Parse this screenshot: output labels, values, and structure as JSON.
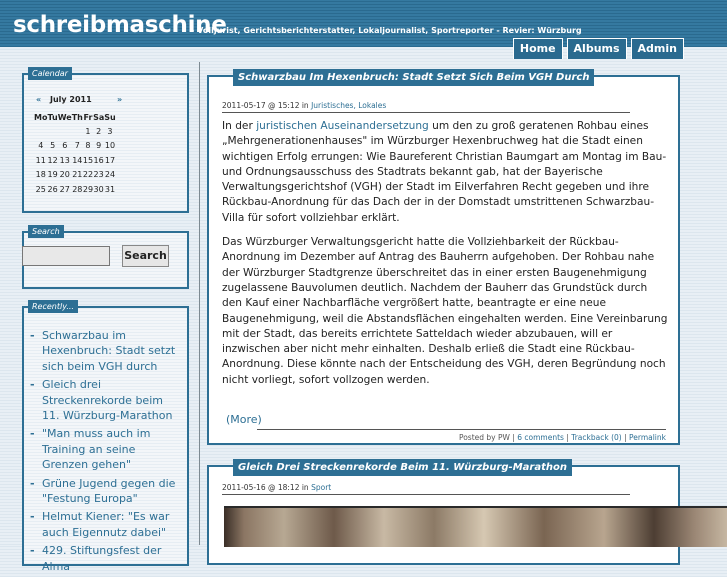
{
  "header": {
    "title": "schreibmaschine",
    "tagline": "- Volljurist, Gerichtsberichterstatter, Lokaljournalist, Sportreporter - Revier: Würzburg",
    "nav": [
      "Home",
      "Albums",
      "Admin"
    ]
  },
  "sidebar": {
    "calendar": {
      "title": "Calendar",
      "prev": "«",
      "month": "July 2011",
      "next": "»",
      "weekdays": [
        "Mo",
        "Tu",
        "We",
        "Th",
        "Fr",
        "Sa",
        "Su"
      ],
      "weeks": [
        [
          "",
          "",
          "",
          "",
          "1",
          "2",
          "3"
        ],
        [
          "4",
          "5",
          "6",
          "7",
          "8",
          "9",
          "10"
        ],
        [
          "11",
          "12",
          "13",
          "14",
          "15",
          "16",
          "17"
        ],
        [
          "18",
          "19",
          "20",
          "21",
          "22",
          "23",
          "24"
        ],
        [
          "25",
          "26",
          "27",
          "28",
          "29",
          "30",
          "31"
        ]
      ]
    },
    "search": {
      "title": "Search",
      "button": "Search"
    },
    "recent": {
      "title": "Recently...",
      "items": [
        "Schwarzbau im Hexenbruch: Stadt setzt sich beim VGH durch",
        "Gleich drei Streckenrekorde beim 11. Würzburg-Marathon",
        "\"Man muss auch im Training an seine Grenzen gehen\"",
        "Grüne Jugend gegen die \"Festung Europa\"",
        "Helmut Kiener: \"Es war auch Eigennutz dabei\"",
        "429. Stiftungsfest der Alma"
      ]
    }
  },
  "posts": [
    {
      "title": "Schwarzbau Im Hexenbruch: Stadt Setzt Sich Beim VGH Durch",
      "date": "2011-05-17 @ 15:12 in",
      "categories": "Juristisches, Lokales",
      "p1_pre": "In der",
      "p1_link": "juristischen Auseinandersetzung",
      "p1_post": "um den zu groß geratenen Rohbau eines „Mehrgenerationenhauses\" im Würzburger Hexenbruchweg hat die Stadt einen wichtigen Erfolg errungen: Wie Baureferent Christian Baumgart am Montag im Bau- und Ordnungsausschuss des Stadtrats bekannt gab, hat der Bayerische Verwaltungsgerichtshof (VGH) der Stadt im Eilverfahren Recht gegeben und ihre Rückbau-Anordnung für das Dach der in der Domstadt umstrittenen Schwarzbau-Villa für sofort vollziehbar erklärt.",
      "p2": "Das Würzburger Verwaltungsgericht hatte die Vollziehbarkeit der Rückbau-Anordnung im Dezember auf Antrag des Bauherrn aufgehoben. Der Rohbau nahe der Würzburger Stadtgrenze überschreitet das in einer ersten Baugenehmigung zugelassene Bauvolumen deutlich. Nachdem der Bauherr das Grundstück durch den Kauf einer Nachbarfläche vergrößert hatte, beantragte er eine neue Baugenehmigung, weil die Abstandsflächen eingehalten werden. Eine Vereinbarung mit der Stadt, das bereits errichtete Satteldach wieder abzubauen, will er inzwischen aber nicht mehr einhalten. Deshalb erließ die Stadt eine Rückbau-Anordnung. Diese könnte nach der Entscheidung des VGH, deren Begründung noch nicht vorliegt, sofort vollzogen werden.",
      "more": "(More)",
      "footer_posted": "Posted by PW |",
      "footer_comments": "6 comments",
      "footer_trackback": "Trackback (0)",
      "footer_permalink": "Permalink"
    },
    {
      "title": "Gleich Drei Streckenrekorde Beim 11. Würzburg-Marathon",
      "date": "2011-05-16 @ 18:12 in",
      "categories": "Sport"
    }
  ]
}
